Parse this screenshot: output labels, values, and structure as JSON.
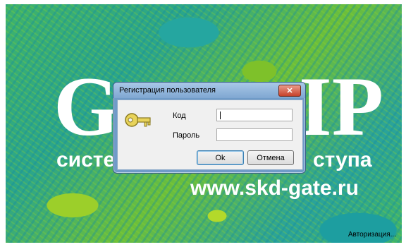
{
  "splash": {
    "logo_left": "G",
    "logo_right": "IP",
    "tagline_left": "систе",
    "tagline_right": "ступа",
    "website": "www.skd-gate.ru",
    "status": "Авторизация..."
  },
  "dialog": {
    "title": "Регистрация пользователя",
    "close_label": "✕",
    "code_label": "Код",
    "code_value": "",
    "password_label": "Пароль",
    "password_value": "",
    "ok_label": "Ok",
    "cancel_label": "Отмена"
  },
  "icons": {
    "key": "key-icon",
    "close": "close-icon"
  }
}
